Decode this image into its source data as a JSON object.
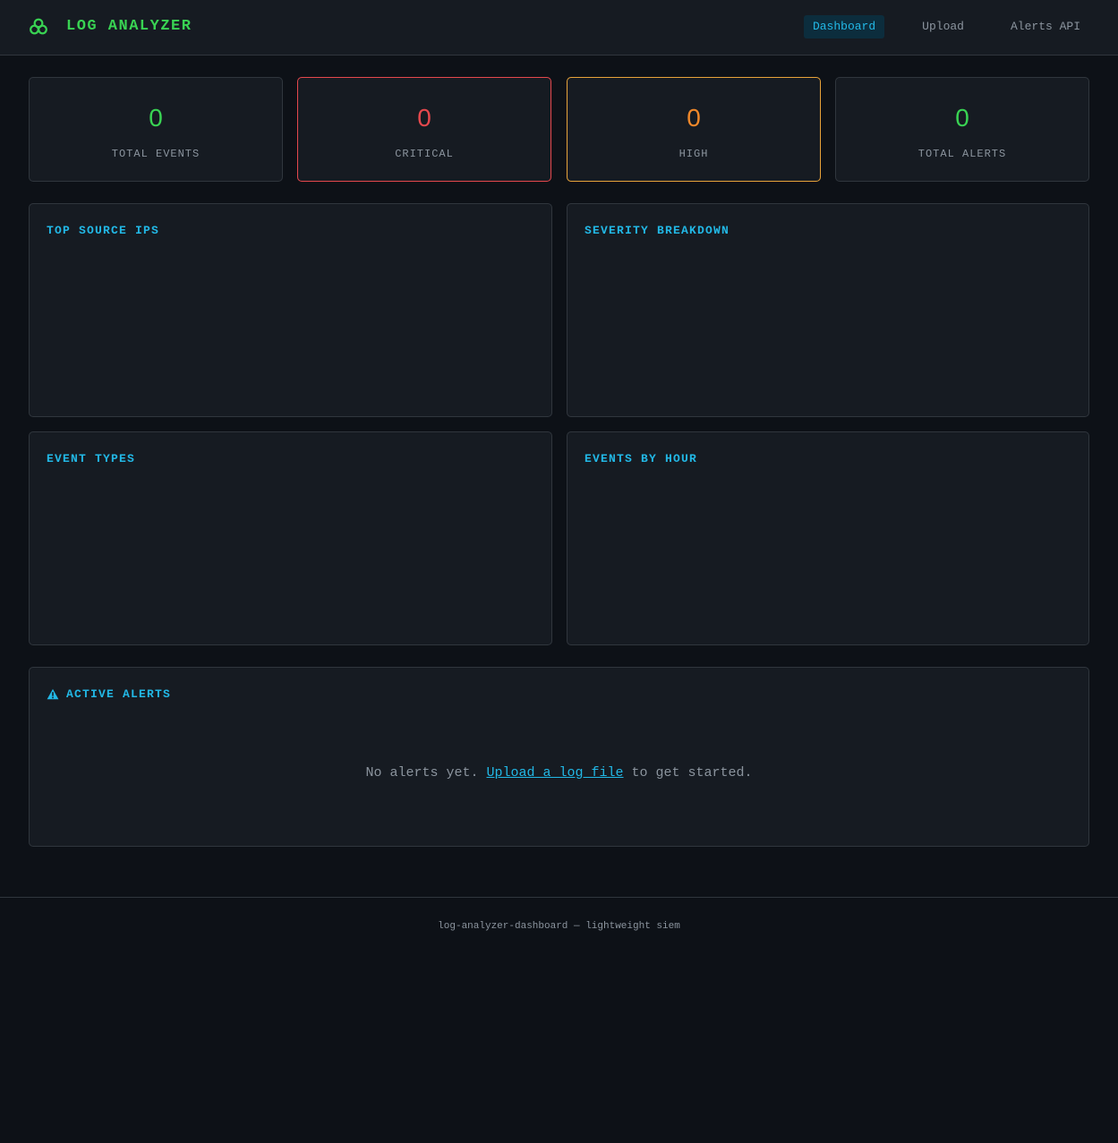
{
  "header": {
    "title": "LOG ANALYZER",
    "icon": "biohazard-icon",
    "nav": [
      {
        "label": "Dashboard",
        "active": true
      },
      {
        "label": "Upload",
        "active": false
      },
      {
        "label": "Alerts API",
        "active": false
      }
    ]
  },
  "stats": [
    {
      "value": "0",
      "label": "TOTAL EVENTS",
      "color": "#39d353"
    },
    {
      "value": "0",
      "label": "CRITICAL",
      "color": "#e5484d"
    },
    {
      "value": "0",
      "label": "HIGH",
      "color": "#f0882a"
    },
    {
      "value": "0",
      "label": "TOTAL ALERTS",
      "color": "#39d353"
    }
  ],
  "panels": {
    "top_source_ips": {
      "title": "TOP SOURCE IPS"
    },
    "severity_breakdown": {
      "title": "SEVERITY BREAKDOWN"
    },
    "event_types": {
      "title": "EVENT TYPES"
    },
    "events_by_hour": {
      "title": "EVENTS BY HOUR"
    }
  },
  "alerts": {
    "title": "ACTIVE ALERTS",
    "icon": "warning-icon",
    "empty_prefix": "No alerts yet. ",
    "empty_link": "Upload a log file",
    "empty_suffix": " to get started."
  },
  "footer": {
    "text": "log-analyzer-dashboard — lightweight siem"
  },
  "colors": {
    "background": "#0d1117",
    "card": "#161b22",
    "border": "#30363d",
    "accent": "#22b8e6",
    "brand": "#39d353"
  }
}
